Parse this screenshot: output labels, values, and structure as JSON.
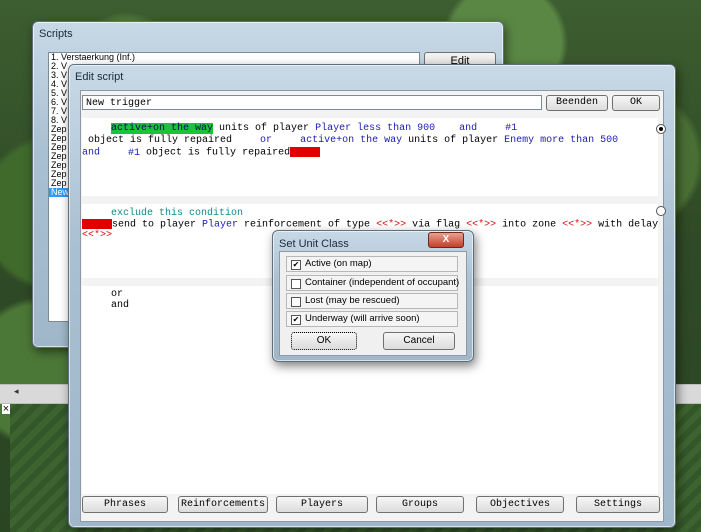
{
  "scripts_window": {
    "title": "Scripts",
    "edit_button": "Edit",
    "items": [
      "1. Verstaerkung (Inf.)",
      "2. V",
      "3. V",
      "4. V",
      "5. V",
      "6. V",
      "7. V",
      "8. V",
      "Zep",
      "Zep",
      "Zep",
      "Zep",
      "Zep",
      "Zep",
      "Zep",
      "New"
    ],
    "selected_index": 15
  },
  "edit_window": {
    "title": "Edit script",
    "trigger_name": "New trigger",
    "beenden_label": "Beenden",
    "ok_label": "OK",
    "conditions": {
      "l1_hl": "active+on the way",
      "l1_a": " units of player ",
      "l1_player": "Player",
      "l1_b": " less than 900",
      "l1_and": "and",
      "l1_ref": "#1",
      "l2_a": "object is fully repaired",
      "l2_or": "or",
      "l2_b": "active+on the way",
      "l2_c": " units of player ",
      "l2_player": "Enemy",
      "l2_d": " more than 500",
      "l3_and": "and",
      "l3_ref": "#1",
      "l3_a": " object is fully repaired"
    },
    "actions": {
      "exclude": "exclude this condition",
      "a_1": "send to player ",
      "a_player": "Player",
      "a_2": " reinforcement of type ",
      "a_type": "<<*>>",
      "a_3": " via flag ",
      "a_flag": "<<*>>",
      "a_4": " into zone ",
      "a_zone": "<<*>>",
      "a_5": " with delay",
      "a_delay": "<<*>>"
    },
    "bottom": {
      "or": "or",
      "and": "and"
    },
    "tabs": [
      "Phrases",
      "Reinforcements",
      "Players",
      "Groups",
      "Objectives",
      "Settings"
    ]
  },
  "unit_dialog": {
    "title": "Set Unit Class",
    "close_symbol": "X",
    "options": [
      {
        "label": "Active (on map)",
        "checked": true
      },
      {
        "label": "Container (independent of occupant)",
        "checked": false
      },
      {
        "label": "Lost (may be rescued)",
        "checked": false
      },
      {
        "label": "Underway (will arrive soon)",
        "checked": true
      }
    ],
    "ok_label": "OK",
    "cancel_label": "Cancel"
  },
  "colors": {
    "selection": "#3399ff",
    "highlight_green": "#19c43a",
    "highlight_red": "#e00000",
    "keyword_blue": "#1c1cb0",
    "keyword_teal": "#0d8a8a",
    "keyword_red": "#d01010"
  }
}
